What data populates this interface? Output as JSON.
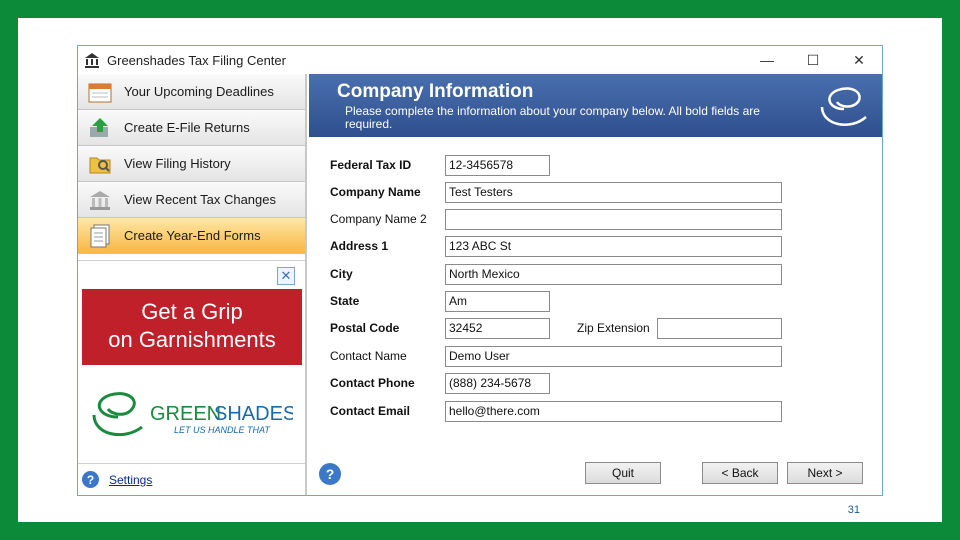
{
  "window": {
    "title": "Greenshades Tax Filing Center",
    "minimize": "—",
    "maximize": "☐",
    "close": "✕"
  },
  "sidebar": {
    "items": [
      {
        "label": "Your Upcoming Deadlines"
      },
      {
        "label": "Create E-File Returns"
      },
      {
        "label": "View Filing History"
      },
      {
        "label": "View Recent Tax Changes"
      },
      {
        "label": "Create Year-End Forms"
      }
    ],
    "ad": {
      "close": "✕",
      "line1": "Get a Grip",
      "line2": "on Garnishments",
      "brand_green": "GREEN",
      "brand_shades": "SHADES",
      "tagline": "LET US HANDLE THAT"
    },
    "help": "?",
    "settings": "Settings"
  },
  "header": {
    "title": "Company Information",
    "subtitle": "Please complete the information about your company below.  All bold fields are required."
  },
  "form": {
    "federal_tax_id": {
      "label": "Federal Tax ID",
      "value": "12-3456578"
    },
    "company_name": {
      "label": "Company Name",
      "value": "Test Testers"
    },
    "company_name_2": {
      "label": "Company Name 2",
      "value": ""
    },
    "address_1": {
      "label": "Address 1",
      "value": "123 ABC St"
    },
    "city": {
      "label": "City",
      "value": "North Mexico"
    },
    "state": {
      "label": "State",
      "value": "Am"
    },
    "postal_code": {
      "label": "Postal Code",
      "value": "32452"
    },
    "zip_extension": {
      "label": "Zip Extension",
      "value": ""
    },
    "contact_name": {
      "label": "Contact Name",
      "value": "Demo User"
    },
    "contact_phone": {
      "label": "Contact Phone",
      "value": "(888) 234-5678"
    },
    "contact_email": {
      "label": "Contact Email",
      "value": "hello@there.com"
    }
  },
  "buttons": {
    "help": "?",
    "quit": "Quit",
    "back": "< Back",
    "next": "Next >"
  },
  "slide_number": "31",
  "colors": {
    "frame": "#0c8a3a",
    "header": "#3a5d9e",
    "active_nav": "#f8b642",
    "ad_red": "#c0202a",
    "brand_green": "#1a8a3e"
  }
}
